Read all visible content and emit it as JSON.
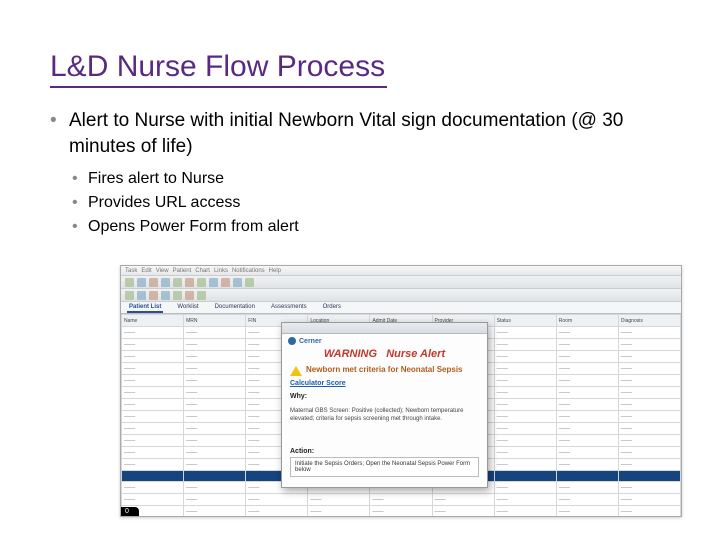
{
  "title": "L&D Nurse Flow Process",
  "bullets": {
    "main": "Alert to Nurse with initial Newborn Vital sign documentation (@ 30 minutes of life)",
    "sub": [
      "Fires alert to Nurse",
      "Provides URL access",
      "Opens Power Form from alert"
    ]
  },
  "app": {
    "menubar": [
      "Task",
      "Edit",
      "View",
      "Patient",
      "Chart",
      "Links",
      "Notifications",
      "Help"
    ],
    "tabs": {
      "items": [
        "Patient List",
        "Worklist",
        "Documentation",
        "Assessments",
        "Orders"
      ],
      "active": "Patient List"
    },
    "right_note": "",
    "columns": [
      "Name",
      "MRN",
      "FIN",
      "Location",
      "Admit Date",
      "Provider",
      "Status",
      "Room",
      "Diagnosis"
    ],
    "corner": "0"
  },
  "alert": {
    "brand": "Cerner",
    "heading_left": "WARNING",
    "heading_right": "Nurse Alert",
    "criteria": "Newborn met criteria for Neonatal Sepsis",
    "link_label": "Calculator Score",
    "why_label": "Why:",
    "why_body": "Maternal GBS Screen: Positive (collected); Newborn temperature elevated; criteria for sepsis screening met through intake.",
    "action_label": "Action:",
    "action_body": "Initiate the Sepsis Orders; Open the Neonatal Sepsis Power Form below"
  }
}
